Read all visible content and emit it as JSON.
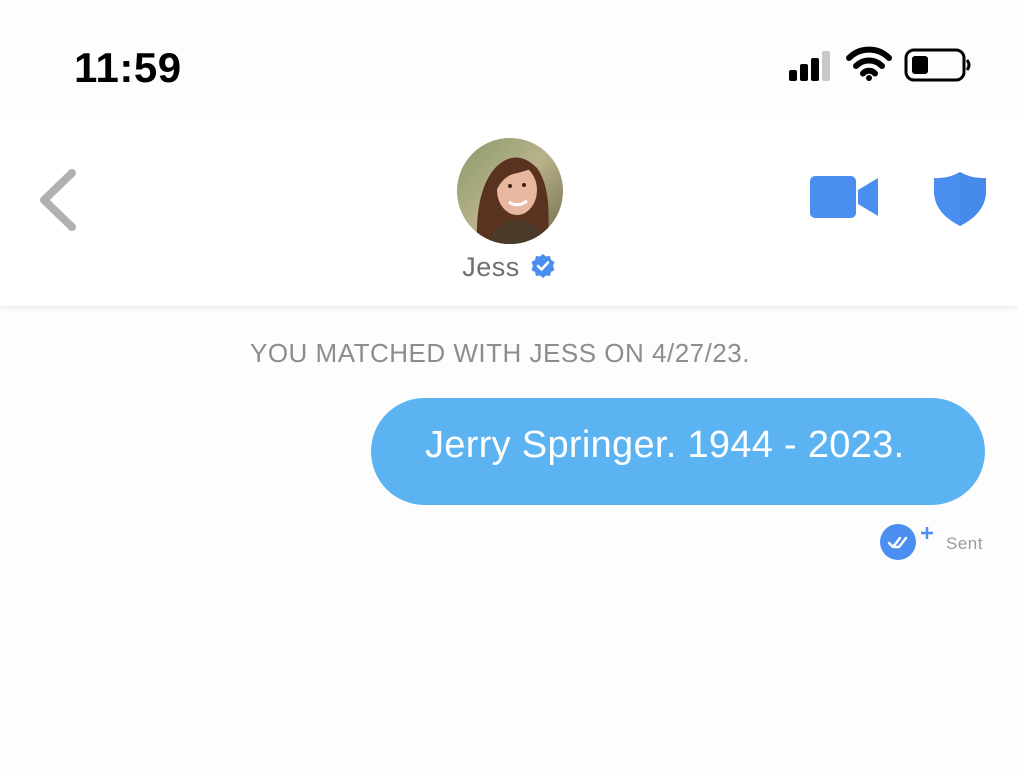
{
  "status_bar": {
    "time": "11:59",
    "signal_icon": "cellular-signal-icon",
    "wifi_icon": "wifi-icon",
    "battery_icon": "battery-low-icon"
  },
  "header": {
    "back_icon": "chevron-left-icon",
    "match_name": "Jess",
    "verified_icon": "verified-badge-icon",
    "video_icon": "video-camera-icon",
    "safety_icon": "shield-icon"
  },
  "conversation": {
    "match_notice": "YOU MATCHED WITH JESS ON 4/27/23.",
    "messages": [
      {
        "text": "Jerry Springer. 1944 - 2023.",
        "direction": "outgoing",
        "status": "Sent"
      }
    ]
  },
  "colors": {
    "accent_blue": "#4a8ff0",
    "bubble_blue": "#5bb3f2",
    "muted_gray": "#8d8d8d"
  }
}
